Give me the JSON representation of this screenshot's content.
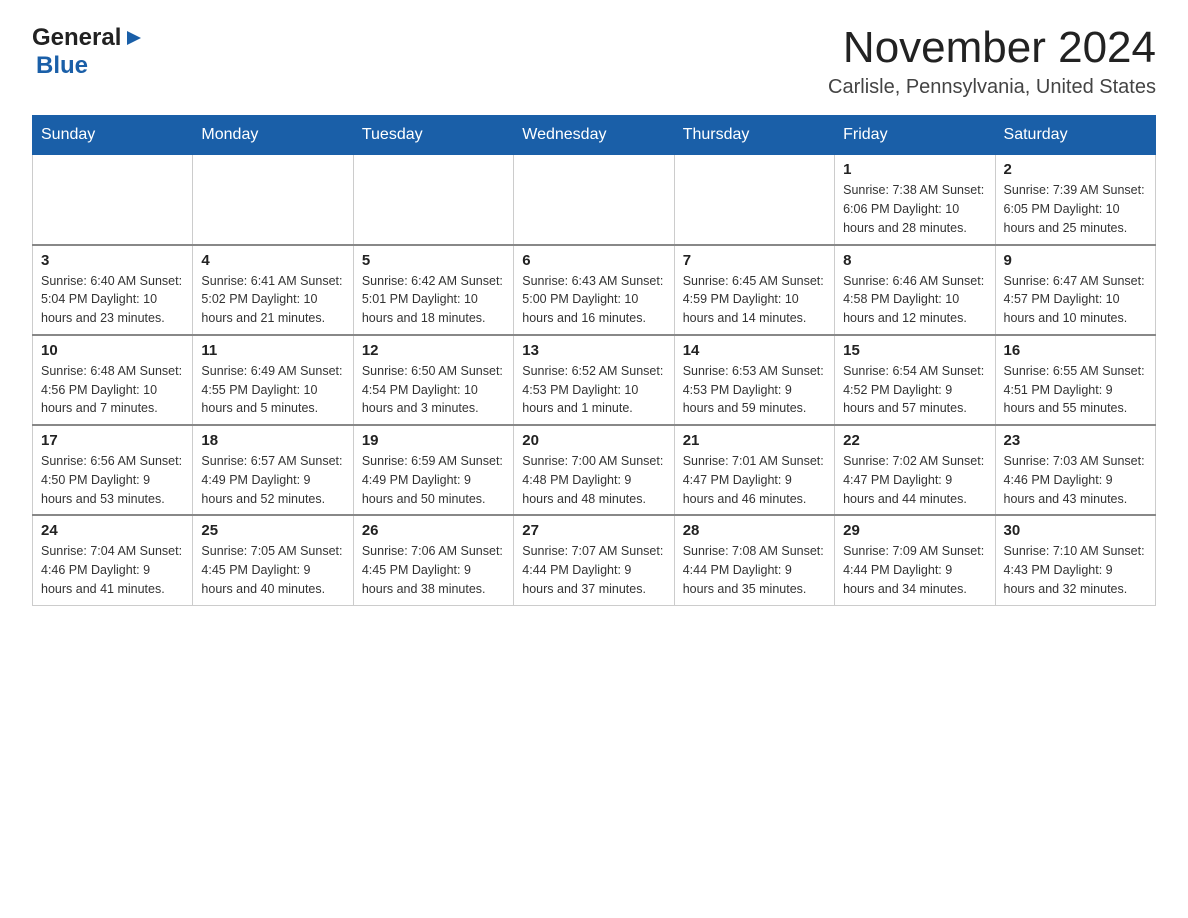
{
  "header": {
    "logo_general": "General",
    "logo_blue": "Blue",
    "month_title": "November 2024",
    "location": "Carlisle, Pennsylvania, United States"
  },
  "days_of_week": [
    "Sunday",
    "Monday",
    "Tuesday",
    "Wednesday",
    "Thursday",
    "Friday",
    "Saturday"
  ],
  "weeks": [
    [
      {
        "day": "",
        "info": ""
      },
      {
        "day": "",
        "info": ""
      },
      {
        "day": "",
        "info": ""
      },
      {
        "day": "",
        "info": ""
      },
      {
        "day": "",
        "info": ""
      },
      {
        "day": "1",
        "info": "Sunrise: 7:38 AM\nSunset: 6:06 PM\nDaylight: 10 hours and 28 minutes."
      },
      {
        "day": "2",
        "info": "Sunrise: 7:39 AM\nSunset: 6:05 PM\nDaylight: 10 hours and 25 minutes."
      }
    ],
    [
      {
        "day": "3",
        "info": "Sunrise: 6:40 AM\nSunset: 5:04 PM\nDaylight: 10 hours and 23 minutes."
      },
      {
        "day": "4",
        "info": "Sunrise: 6:41 AM\nSunset: 5:02 PM\nDaylight: 10 hours and 21 minutes."
      },
      {
        "day": "5",
        "info": "Sunrise: 6:42 AM\nSunset: 5:01 PM\nDaylight: 10 hours and 18 minutes."
      },
      {
        "day": "6",
        "info": "Sunrise: 6:43 AM\nSunset: 5:00 PM\nDaylight: 10 hours and 16 minutes."
      },
      {
        "day": "7",
        "info": "Sunrise: 6:45 AM\nSunset: 4:59 PM\nDaylight: 10 hours and 14 minutes."
      },
      {
        "day": "8",
        "info": "Sunrise: 6:46 AM\nSunset: 4:58 PM\nDaylight: 10 hours and 12 minutes."
      },
      {
        "day": "9",
        "info": "Sunrise: 6:47 AM\nSunset: 4:57 PM\nDaylight: 10 hours and 10 minutes."
      }
    ],
    [
      {
        "day": "10",
        "info": "Sunrise: 6:48 AM\nSunset: 4:56 PM\nDaylight: 10 hours and 7 minutes."
      },
      {
        "day": "11",
        "info": "Sunrise: 6:49 AM\nSunset: 4:55 PM\nDaylight: 10 hours and 5 minutes."
      },
      {
        "day": "12",
        "info": "Sunrise: 6:50 AM\nSunset: 4:54 PM\nDaylight: 10 hours and 3 minutes."
      },
      {
        "day": "13",
        "info": "Sunrise: 6:52 AM\nSunset: 4:53 PM\nDaylight: 10 hours and 1 minute."
      },
      {
        "day": "14",
        "info": "Sunrise: 6:53 AM\nSunset: 4:53 PM\nDaylight: 9 hours and 59 minutes."
      },
      {
        "day": "15",
        "info": "Sunrise: 6:54 AM\nSunset: 4:52 PM\nDaylight: 9 hours and 57 minutes."
      },
      {
        "day": "16",
        "info": "Sunrise: 6:55 AM\nSunset: 4:51 PM\nDaylight: 9 hours and 55 minutes."
      }
    ],
    [
      {
        "day": "17",
        "info": "Sunrise: 6:56 AM\nSunset: 4:50 PM\nDaylight: 9 hours and 53 minutes."
      },
      {
        "day": "18",
        "info": "Sunrise: 6:57 AM\nSunset: 4:49 PM\nDaylight: 9 hours and 52 minutes."
      },
      {
        "day": "19",
        "info": "Sunrise: 6:59 AM\nSunset: 4:49 PM\nDaylight: 9 hours and 50 minutes."
      },
      {
        "day": "20",
        "info": "Sunrise: 7:00 AM\nSunset: 4:48 PM\nDaylight: 9 hours and 48 minutes."
      },
      {
        "day": "21",
        "info": "Sunrise: 7:01 AM\nSunset: 4:47 PM\nDaylight: 9 hours and 46 minutes."
      },
      {
        "day": "22",
        "info": "Sunrise: 7:02 AM\nSunset: 4:47 PM\nDaylight: 9 hours and 44 minutes."
      },
      {
        "day": "23",
        "info": "Sunrise: 7:03 AM\nSunset: 4:46 PM\nDaylight: 9 hours and 43 minutes."
      }
    ],
    [
      {
        "day": "24",
        "info": "Sunrise: 7:04 AM\nSunset: 4:46 PM\nDaylight: 9 hours and 41 minutes."
      },
      {
        "day": "25",
        "info": "Sunrise: 7:05 AM\nSunset: 4:45 PM\nDaylight: 9 hours and 40 minutes."
      },
      {
        "day": "26",
        "info": "Sunrise: 7:06 AM\nSunset: 4:45 PM\nDaylight: 9 hours and 38 minutes."
      },
      {
        "day": "27",
        "info": "Sunrise: 7:07 AM\nSunset: 4:44 PM\nDaylight: 9 hours and 37 minutes."
      },
      {
        "day": "28",
        "info": "Sunrise: 7:08 AM\nSunset: 4:44 PM\nDaylight: 9 hours and 35 minutes."
      },
      {
        "day": "29",
        "info": "Sunrise: 7:09 AM\nSunset: 4:44 PM\nDaylight: 9 hours and 34 minutes."
      },
      {
        "day": "30",
        "info": "Sunrise: 7:10 AM\nSunset: 4:43 PM\nDaylight: 9 hours and 32 minutes."
      }
    ]
  ]
}
